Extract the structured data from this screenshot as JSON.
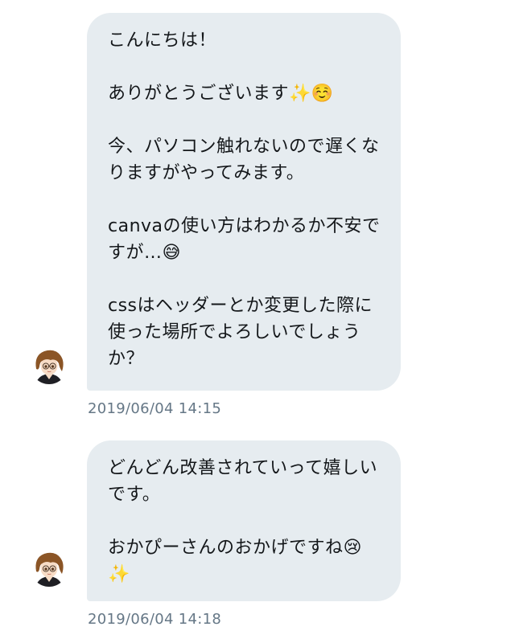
{
  "messages": [
    {
      "paragraphs": [
        "こんにちは！",
        "ありがとうございます✨☺️",
        "今、パソコン触れないので遅くなりますがやってみます。",
        "canvaの使い方はわかるか不安ですが…😅",
        "cssはヘッダーとか変更した際に使った場所でよろしいでしょうか？"
      ],
      "timestamp": "2019/06/04 14:15"
    },
    {
      "paragraphs": [
        "どんどん改善されていって嬉しいです。",
        "おかぴーさんのおかげですね😢 ✨"
      ],
      "timestamp": "2019/06/04 14:18"
    }
  ],
  "colors": {
    "bubble": "#e6ecf0",
    "text": "#14171a",
    "timestamp": "#657786"
  },
  "avatar_icon": "anime-girl-avatar-icon"
}
